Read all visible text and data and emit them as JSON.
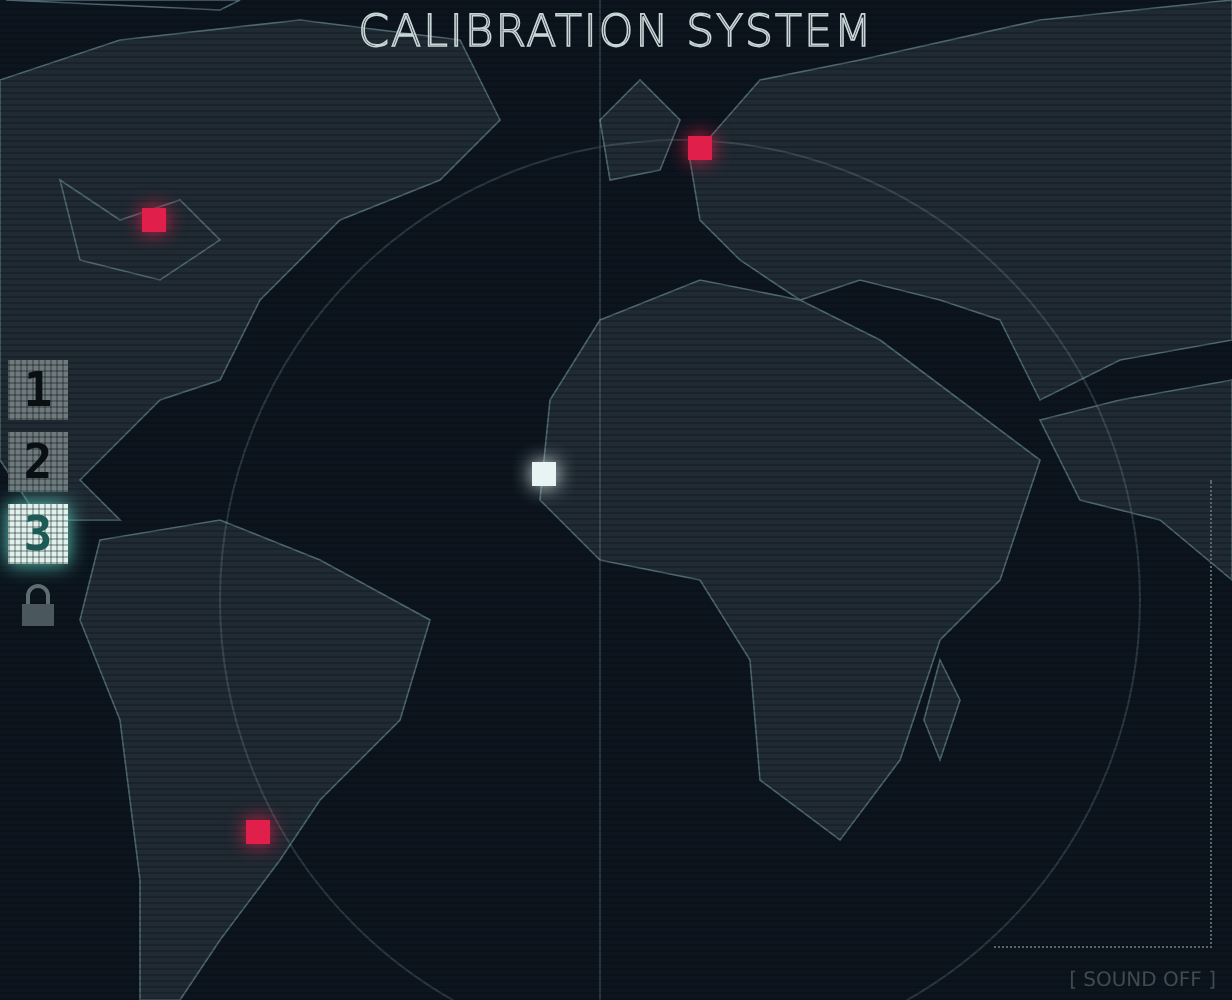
{
  "title": "CALIBRATION SYSTEM",
  "levels": [
    {
      "label": "1",
      "selected": false
    },
    {
      "label": "2",
      "selected": false
    },
    {
      "label": "3",
      "selected": true
    }
  ],
  "locked_level": {
    "locked": true
  },
  "markers": [
    {
      "color": "#e0204a"
    },
    {
      "color": "#e0204a"
    },
    {
      "color": "#e8f4f4"
    },
    {
      "color": "#e0204a"
    }
  ],
  "sound_toggle": "[ SOUND OFF ]"
}
